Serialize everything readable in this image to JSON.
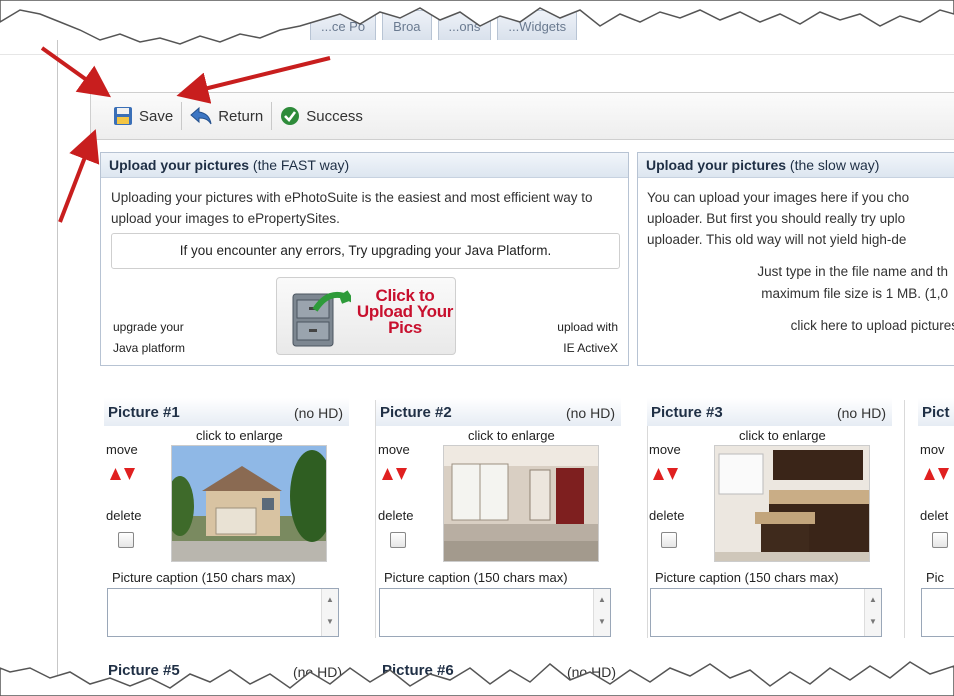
{
  "tabs": [
    "...ce Po",
    "Broa",
    "...ons",
    "...Widgets"
  ],
  "toolbar": {
    "save": "Save",
    "return": "Return",
    "success": "Success"
  },
  "fast_panel": {
    "title_bold": "Upload your pictures",
    "title_rest": " (the FAST way)",
    "text": "Uploading your pictures with ePhotoSuite is the easiest and most efficient way to upload your images to ePropertySites.",
    "notice": "If you encounter any errors, Try upgrading your Java Platform.",
    "upgrade_1": "upgrade your",
    "upgrade_2": "Java platform",
    "upload_btn": "Click to Upload Your Pics",
    "activex_1": "upload with",
    "activex_2": "IE ActiveX"
  },
  "slow_panel": {
    "title_bold": "Upload your pictures",
    "title_rest": " (the slow way)",
    "line1": "You can upload your images here if you cho",
    "line2": "uploader. But first you should really try uplo",
    "line3": "uploader. This old way will not yield high-de",
    "line4": "Just type in the file name and th",
    "line5": "maximum file size is 1 MB. (1,0",
    "line6": "click here to upload pictures"
  },
  "pictures": [
    {
      "title": "Picture #1",
      "hd": "(no HD)",
      "enlarge": "click to enlarge",
      "move": "move",
      "delete": "delete",
      "caption": "Picture caption (150 chars max)",
      "image": "house-exterior"
    },
    {
      "title": "Picture #2",
      "hd": "(no HD)",
      "enlarge": "click to enlarge",
      "move": "move",
      "delete": "delete",
      "caption": "Picture caption (150 chars max)",
      "image": "living-room"
    },
    {
      "title": "Picture #3",
      "hd": "(no HD)",
      "enlarge": "click to enlarge",
      "move": "move",
      "delete": "delete",
      "caption": "Picture caption (150 chars max)",
      "image": "kitchen"
    },
    {
      "title": "Pict",
      "move": "mov",
      "delete": "delet",
      "caption": "Pic"
    }
  ],
  "pictures_row2": [
    {
      "title": "Picture #5",
      "hd": "(no HD)"
    },
    {
      "title": "Picture #6",
      "hd": "(no HD)"
    }
  ],
  "colors": {
    "annotation_arrow": "#c81e1e",
    "move_arrows": "#e02020",
    "header_bg": "#dde6f0"
  }
}
